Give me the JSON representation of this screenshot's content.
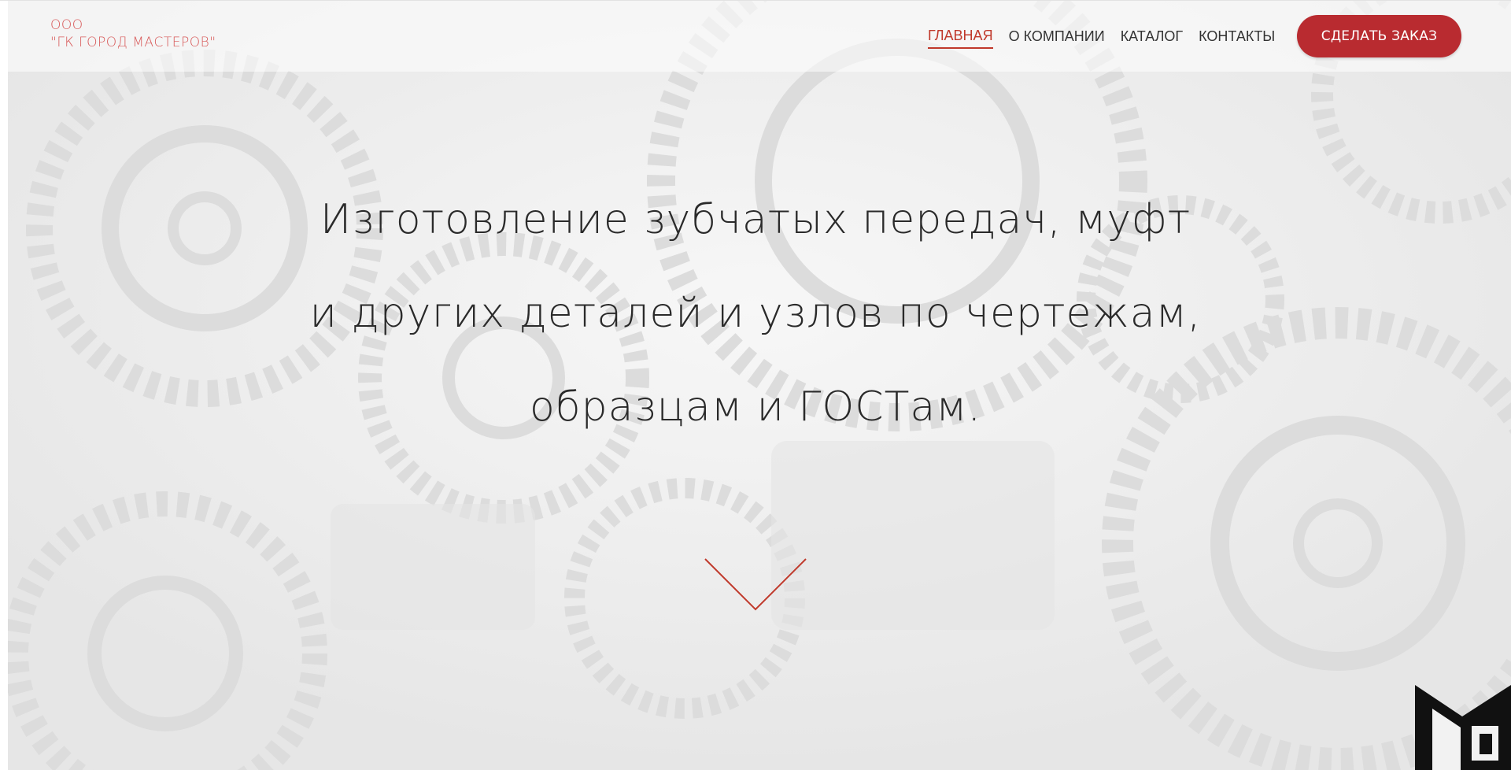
{
  "logo": {
    "line1": "ООО",
    "line2": "\"ГК ГОРОД МАСТЕРОВ\""
  },
  "nav": {
    "items": [
      {
        "label": "ГЛАВНАЯ",
        "active": true
      },
      {
        "label": "О КОМПАНИИ",
        "active": false
      },
      {
        "label": "КАТАЛОГ",
        "active": false
      },
      {
        "label": "КОНТАКТЫ",
        "active": false
      }
    ],
    "order_button": "СДЕЛАТЬ ЗАКАЗ"
  },
  "hero": {
    "line1": "Изготовление зубчатых передач, муфт",
    "line2": "и других деталей и узлов по чертежам,",
    "line3": "образцам и ГОСТам."
  },
  "icons": {
    "scroll_down": "chevron-down-icon",
    "corner_badge": "brand-badge-icon"
  },
  "colors": {
    "accent": "#b92b30",
    "logo": "#d85a5a",
    "text": "#2a2a2a"
  }
}
